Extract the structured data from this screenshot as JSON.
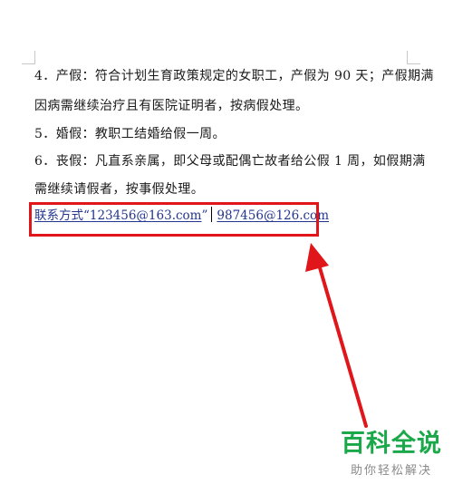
{
  "document": {
    "lines": [
      "4．产假：符合计划生育政策规定的女职工，产假为 90 天；产假期满",
      "因病需继续治疗且有医院证明者，按病假处理。",
      "5．婚假：教职工结婚给假一周。",
      "6．丧假：凡直系亲属，即父母或配偶亡故者给公假 1 周，如假期满",
      "需继续请假者，按事假处理。"
    ],
    "contact_link_1": "联系方式“123456@163.com",
    "contact_quote_end": "”",
    "contact_link_2": "987456@126.com"
  },
  "annotation": {
    "highlight_color": "#e0161a"
  },
  "watermark": {
    "title": "百科全说",
    "subtitle": "助你轻松解决",
    "title_color": "#1aa84a"
  }
}
